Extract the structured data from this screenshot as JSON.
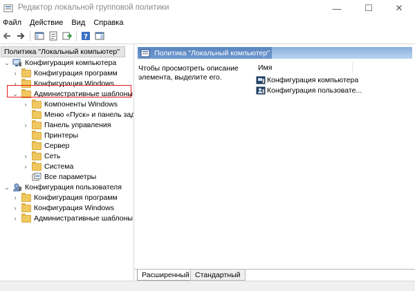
{
  "window": {
    "title": "Редактор локальной групповой политики",
    "minimize_glyph": "—",
    "maximize_glyph": "☐",
    "close_glyph": "✕"
  },
  "menu": [
    "Файл",
    "Действие",
    "Вид",
    "Справка"
  ],
  "toolbar": {
    "buttons": [
      "back-icon",
      "forward-icon",
      "show-hide-tree-icon",
      "properties-icon",
      "export-list-icon",
      "help-icon",
      "show-hide-action-pane-icon"
    ]
  },
  "tree": {
    "root": "Политика \"Локальный компьютер\"",
    "computer": {
      "label": "Конфигурация компьютера",
      "children": [
        "Конфигурация программ",
        "Конфигурация Windows",
        "Административные шаблоны"
      ],
      "admin_children": [
        "Компоненты Windows",
        "Меню «Пуск» и панель задач",
        "Панель управления",
        "Принтеры",
        "Сервер",
        "Сеть",
        "Система",
        "Все параметры"
      ]
    },
    "user": {
      "label": "Конфигурация пользователя",
      "children": [
        "Конфигурация программ",
        "Конфигурация Windows",
        "Административные шаблоны"
      ]
    },
    "expanded_glyph": "⌄",
    "collapsed_glyph": "›"
  },
  "right_pane": {
    "header": "Политика \"Локальный компьютер\"",
    "description": "Чтобы просмотреть описание элемента, выделите его.",
    "column_name": "Имя",
    "items": [
      "Конфигурация компьютера",
      "Конфигурация пользовате..."
    ]
  },
  "tabs": {
    "extended": "Расширенный",
    "standard": "Стандартный"
  },
  "colors": {
    "header_blue": "#5a86c0",
    "highlight_red": "#e21b1b",
    "folder_yellow": "#f0c860"
  }
}
